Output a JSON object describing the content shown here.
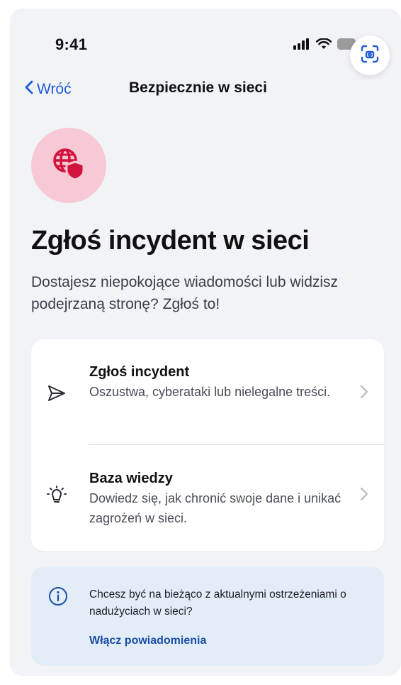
{
  "status_bar": {
    "time": "9:41",
    "icons": [
      "signal-icon",
      "wifi-icon",
      "battery-icon",
      "screen-scan-icon"
    ]
  },
  "nav": {
    "back_label": "Wróć",
    "title": "Bezpiecznie w sieci"
  },
  "hero": {
    "icon": "globe-shield-icon",
    "title": "Zgłoś incydent w sieci",
    "subtitle": "Dostajesz niepokojące wiadomości lub widzisz podejrzaną stronę? Zgłoś to!"
  },
  "menu": {
    "items": [
      {
        "icon": "send-icon",
        "title": "Zgłoś incydent",
        "description": "Oszustwa, cyberataki lub nielegalne treści."
      },
      {
        "icon": "lightbulb-icon",
        "title": "Baza wiedzy",
        "description": "Dowiedz się, jak chronić swoje dane i unikać zagrożeń w sieci."
      }
    ]
  },
  "info": {
    "icon": "info-icon",
    "text": "Chcesz być na bieżąco z aktualnymi ostrzeżeniami o nadużyciach w sieci?",
    "link_label": "Włącz powiadomienia"
  },
  "colors": {
    "accent": "#1f5bd8",
    "hero_icon_bg": "#f7c9d4",
    "hero_icon_fg": "#d3133f",
    "info_bg": "#e3edf8",
    "background": "#f2f3f7"
  }
}
